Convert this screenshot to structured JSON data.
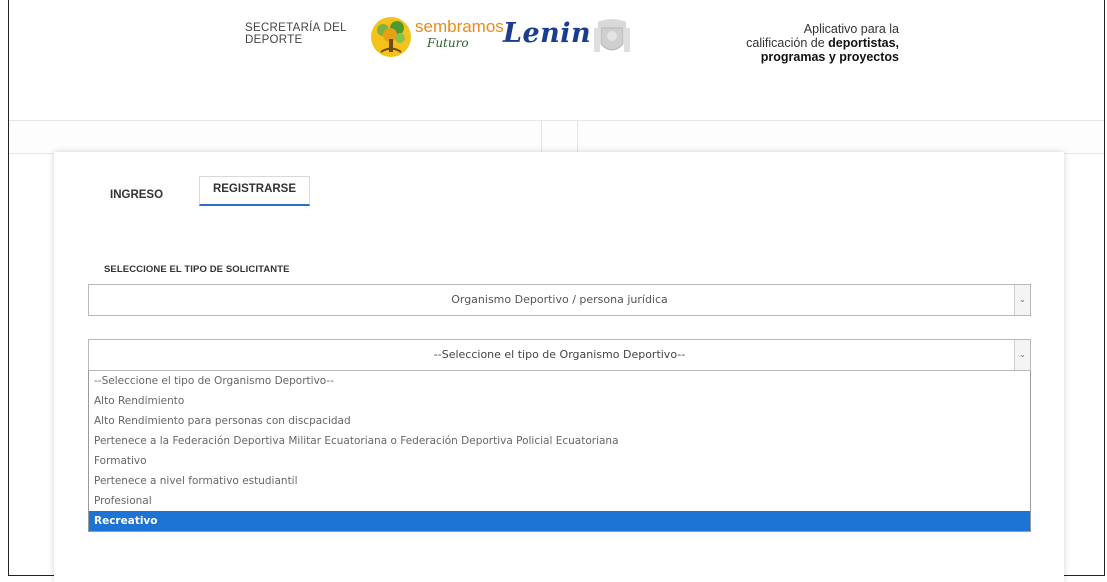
{
  "header": {
    "secretaria_line1": "SECRETARÍA DEL",
    "secretaria_line2": "DEPORTE",
    "sembramos": "sembramos",
    "futuro": "Futuro",
    "lenin": "Lenin",
    "app_desc_line1": "Aplicativo para la",
    "app_desc_line2_pre": "calificación de ",
    "app_desc_line2_bold": "deportistas,",
    "app_desc_line3": "programas y proyectos"
  },
  "tabs": {
    "ingreso": "INGRESO",
    "registrarse": "REGISTRARSE"
  },
  "form": {
    "label": "SELECCIONE EL TIPO DE SOLICITANTE",
    "tipo_solicitante": "Organismo Deportivo / persona jurídica",
    "tipo_organismo": "--Seleccione el tipo de Organismo Deportivo--",
    "options": [
      "--Seleccione el tipo de Organismo Deportivo--",
      "Alto Rendimiento",
      "Alto Rendimiento para personas con discpacidad",
      "Pertenece a la Federación Deportiva Militar Ecuatoriana o Federación Deportiva Policial Ecuatoriana",
      "Formativo",
      "Pertenece a nivel formativo estudiantil",
      "Profesional",
      "Recreativo"
    ],
    "highlighted_option": "Recreativo"
  },
  "colors": {
    "highlight": "#1e74d4",
    "tab_underline": "#2b72c4",
    "lenin_blue": "#1b3d91",
    "sembramos_orange": "#ea8a1a"
  }
}
